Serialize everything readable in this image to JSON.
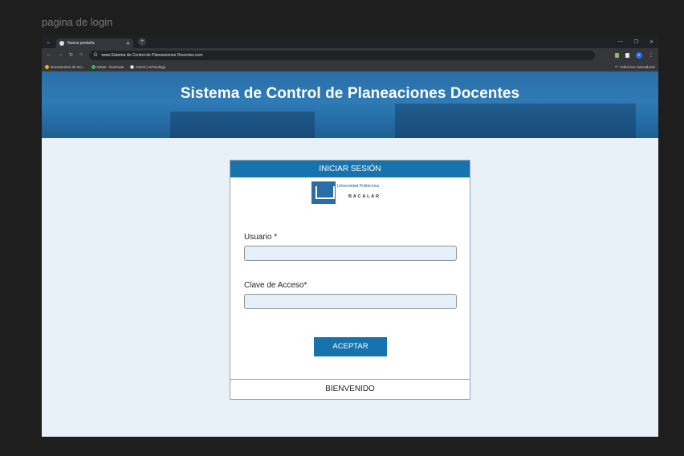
{
  "frame_label": "pagina de login",
  "browser": {
    "tab_title": "Nueva pestaña",
    "url": "www.Sistema de Control de Planeaciones Docentes.com",
    "profile_initial": "R",
    "bookmarks": [
      "Documentos de Go...",
      "Notas - Evernote",
      "Home | Schoology"
    ],
    "bookmarks_all": "Todos los marcadores"
  },
  "page": {
    "header_title": "Sistema de Control de Planeaciones Docentes",
    "login": {
      "title": "INICIAR SESIÓN",
      "logo_university": "Universidad Politécnica",
      "logo_campus": "BACALAR",
      "username_label": "Usuario *",
      "password_label": "Clave de Acceso*",
      "accept_label": "ACEPTAR",
      "footer_text": "BIENVENIDO"
    }
  },
  "colors": {
    "accent": "#1673ae",
    "page_bg": "#e9f1f8",
    "header_bg": "#2a6ea7"
  }
}
